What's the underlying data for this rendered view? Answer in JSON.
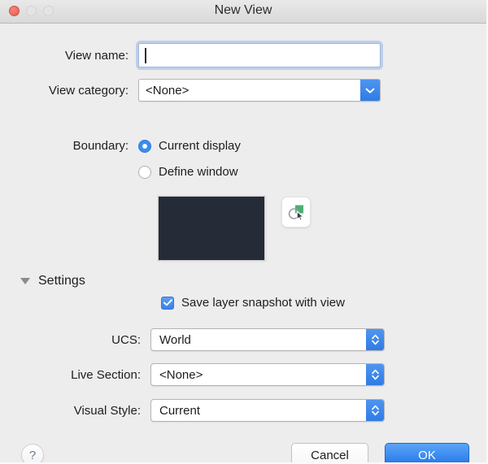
{
  "window": {
    "title": "New View",
    "traffic_lights": [
      {
        "name": "close",
        "state": "active",
        "color": "#ec6a5e"
      },
      {
        "name": "minimize",
        "state": "disabled",
        "color": "#e4e4e4"
      },
      {
        "name": "maximize",
        "state": "disabled",
        "color": "#e4e4e4"
      }
    ]
  },
  "form": {
    "view_name": {
      "label": "View name:",
      "value": "",
      "placeholder": ""
    },
    "view_category": {
      "label": "View category:",
      "value": "<None>",
      "options": [
        "<None>"
      ]
    },
    "boundary": {
      "label": "Boundary:",
      "selected": "Current display",
      "options": [
        {
          "label": "Current display",
          "selected": true
        },
        {
          "label": "Define window",
          "selected": false
        }
      ]
    },
    "preview": {
      "name": "boundary-preview-thumbnail",
      "color": "#262b38"
    },
    "pick_window_button": {
      "name": "define-window-picker-icon",
      "accent": "#4caf72"
    }
  },
  "settings": {
    "label": "Settings",
    "expanded": true,
    "save_layer_snapshot": {
      "label": "Save layer snapshot with view",
      "checked": true
    },
    "ucs": {
      "label": "UCS:",
      "value": "World",
      "options": [
        "World"
      ]
    },
    "live_section": {
      "label": "Live Section:",
      "value": "<None>",
      "options": [
        "<None>"
      ]
    },
    "visual_style": {
      "label": "Visual Style:",
      "value": "Current",
      "options": [
        "Current"
      ]
    }
  },
  "footer": {
    "help_label": "?",
    "cancel_label": "Cancel",
    "ok_label": "OK",
    "ok_accent": "#3f8ef1"
  }
}
